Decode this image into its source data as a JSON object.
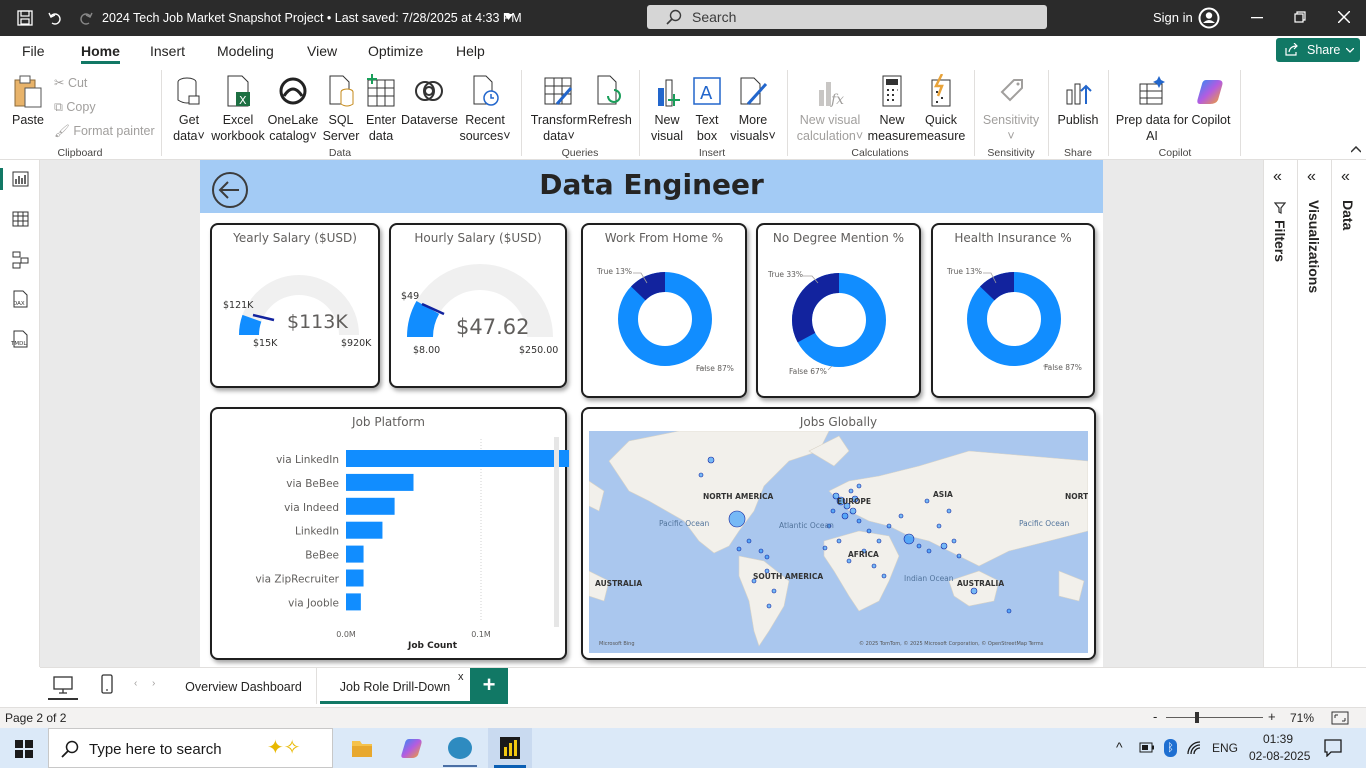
{
  "titlebar": {
    "title": "2024 Tech Job Market Snapshot Project • Last saved: 7/28/2025 at 4:33 PM",
    "search_placeholder": "Search",
    "signin": "Sign in"
  },
  "menu": {
    "items": [
      "File",
      "Home",
      "Insert",
      "Modeling",
      "View",
      "Optimize",
      "Help"
    ],
    "share": "Share"
  },
  "ribbon": {
    "paste": "Paste",
    "cut": "Cut",
    "copy": "Copy",
    "format_painter": "Format painter",
    "clipboard": "Clipboard",
    "get_data": [
      "Get",
      "data"
    ],
    "excel": [
      "Excel",
      "workbook"
    ],
    "onelake": [
      "OneLake",
      "catalog"
    ],
    "sql": [
      "SQL",
      "Server"
    ],
    "enter": [
      "Enter",
      "data"
    ],
    "dataverse": "Dataverse",
    "recent": [
      "Recent",
      "sources"
    ],
    "data_group": "Data",
    "transform": [
      "Transform",
      "data"
    ],
    "refresh": "Refresh",
    "queries": "Queries",
    "new_visual": [
      "New",
      "visual"
    ],
    "text_box": [
      "Text",
      "box"
    ],
    "more_visuals": [
      "More",
      "visuals"
    ],
    "insert": "Insert",
    "new_visual_calc": [
      "New visual",
      "calculation"
    ],
    "new_measure": [
      "New",
      "measure"
    ],
    "quick_measure": [
      "Quick",
      "measure"
    ],
    "calculations": "Calculations",
    "sensitivity": "Sensitivity",
    "sensitivity_group": "Sensitivity",
    "publish": "Publish",
    "share_group": "Share",
    "prep": [
      "Prep data for",
      "AI"
    ],
    "copilot": "Copilot",
    "copilot_group": "Copilot"
  },
  "report": {
    "title": "Data Engineer"
  },
  "cards": {
    "yearly": {
      "title": "Yearly Salary ($USD)",
      "value": "$113K",
      "min": "$15K",
      "max": "$920K",
      "target": "$121K",
      "fill_fraction": 0.109
    },
    "hourly": {
      "title": "Hourly Salary ($USD)",
      "value": "$47.62",
      "min": "$8.00",
      "max": "$250.00",
      "target": "$49",
      "fill_fraction": 0.164
    },
    "wfh": {
      "title": "Work From Home %",
      "true_label": "True 13%",
      "false_label": "False 87%",
      "true_pct": 13
    },
    "nodegree": {
      "title": "No Degree Mention %",
      "true_label": "True 33%",
      "false_label": "False 67%",
      "true_pct": 33
    },
    "health": {
      "title": "Health Insurance %",
      "true_label": "True 13%",
      "false_label": "False 87%",
      "true_pct": 13
    }
  },
  "chart_data": {
    "type": "bar",
    "title": "Job Platform",
    "xlabel": "Job Count",
    "ylabel": "",
    "categories": [
      "via LinkedIn",
      "via BeBee",
      "via Indeed",
      "LinkedIn",
      "BeBee",
      "via ZipRecruiter",
      "via Jooble"
    ],
    "values": [
      186000,
      50000,
      36000,
      27000,
      13000,
      13000,
      11000
    ],
    "xticks": [
      "0.0M",
      "0.1M"
    ],
    "xlim": [
      0,
      200000
    ],
    "color": "#118dff"
  },
  "map": {
    "title": "Jobs Globally",
    "labels": [
      "NORTH AMERICA",
      "EUROPE",
      "ASIA",
      "NORT",
      "Pacific Ocean",
      "Atlantic Ocean",
      "AFRICA",
      "SOUTH AMERICA",
      "Indian Ocean",
      "Pacific Ocean",
      "AUSTRALIA",
      "AUSTRALIA"
    ],
    "attribution": "© 2025 TomTom, © 2025 Microsoft Corporation, © OpenStreetMap  Terms",
    "logo": "Microsoft Bing"
  },
  "panes": {
    "filters": "Filters",
    "visualizations": "Visualizations",
    "data": "Data"
  },
  "tabs": {
    "t1": "Overview Dashboard",
    "t2": "Job Role Drill-Down",
    "close": "x",
    "add": "+"
  },
  "status": {
    "page": "Page 2 of 2",
    "zoom": "71%",
    "minus": "-",
    "plus": "+"
  },
  "taskbar": {
    "search": "Type here to search",
    "lang": "ENG",
    "time": "01:39",
    "date": "02-08-2025"
  },
  "colors": {
    "accent": "#118dff",
    "dark": "#12239e",
    "header": "#a3cbf5",
    "green": "#117865"
  }
}
